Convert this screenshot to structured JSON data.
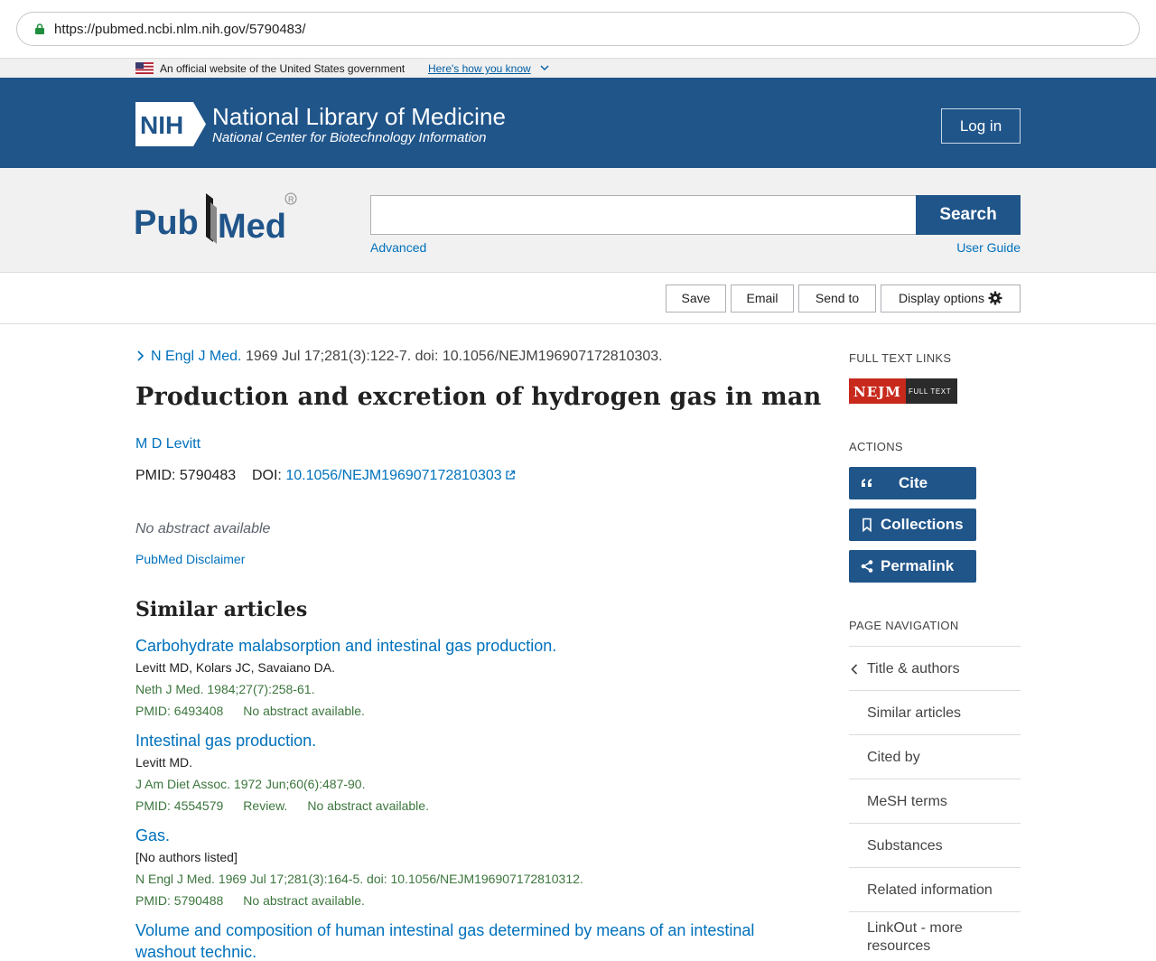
{
  "browser": {
    "url": "https://pubmed.ncbi.nlm.nih.gov/5790483/"
  },
  "gov_banner": {
    "text": "An official website of the United States government",
    "link": "Here's how you know"
  },
  "nih_header": {
    "logo_text": "NIH",
    "title": "National Library of Medicine",
    "subtitle": "National Center for Biotechnology Information",
    "login_label": "Log in"
  },
  "search": {
    "logo_text": "PubMed",
    "value": "",
    "placeholder": "",
    "button_label": "Search",
    "advanced_label": "Advanced",
    "user_guide_label": "User Guide"
  },
  "toolbar": {
    "save": "Save",
    "email": "Email",
    "send_to": "Send to",
    "display_options": "Display options"
  },
  "article": {
    "journal": "N Engl J Med.",
    "citation": "1969 Jul 17;281(3):122-7. doi: 10.1056/NEJM196907172810303.",
    "title": "Production and excretion of hydrogen gas in man",
    "author": "M D Levitt",
    "pmid_label": "PMID:",
    "pmid": "5790483",
    "doi_label": "DOI:",
    "doi": "10.1056/NEJM196907172810303",
    "no_abstract": "No abstract available",
    "disclaimer": "PubMed Disclaimer"
  },
  "similar": {
    "heading": "Similar articles",
    "items": [
      {
        "title": "Carbohydrate malabsorption and intestinal gas production.",
        "authors": "Levitt MD, Kolars JC, Savaiano DA.",
        "cite": "Neth J Med. 1984;27(7):258-61.",
        "pmid": "PMID: 6493408",
        "review": "",
        "note": "No abstract available."
      },
      {
        "title": "Intestinal gas production.",
        "authors": "Levitt MD.",
        "cite": "J Am Diet Assoc. 1972 Jun;60(6):487-90.",
        "pmid": "PMID: 4554579",
        "review": "Review.",
        "note": "No abstract available."
      },
      {
        "title": "Gas.",
        "authors": "[No authors listed]",
        "cite": "N Engl J Med. 1969 Jul 17;281(3):164-5. doi: 10.1056/NEJM196907172810312.",
        "pmid": "PMID: 5790488",
        "review": "",
        "note": "No abstract available."
      },
      {
        "title": "Volume and composition of human intestinal gas determined by means of an intestinal washout technic.",
        "authors": "",
        "cite": "",
        "pmid": "",
        "review": "",
        "note": ""
      }
    ]
  },
  "sidebar": {
    "full_text_heading": "FULL TEXT LINKS",
    "nejm_logo": "NEJM",
    "nejm_tag": "FULL TEXT",
    "actions_heading": "ACTIONS",
    "cite": "Cite",
    "collections": "Collections",
    "permalink": "Permalink",
    "page_nav_heading": "PAGE NAVIGATION",
    "nav": [
      "Title & authors",
      "Similar articles",
      "Cited by",
      "MeSH terms",
      "Substances",
      "Related information",
      "LinkOut - more resources"
    ]
  },
  "colors": {
    "nih_blue": "#20558a",
    "link": "#0071bc",
    "green": "#3c763d"
  }
}
